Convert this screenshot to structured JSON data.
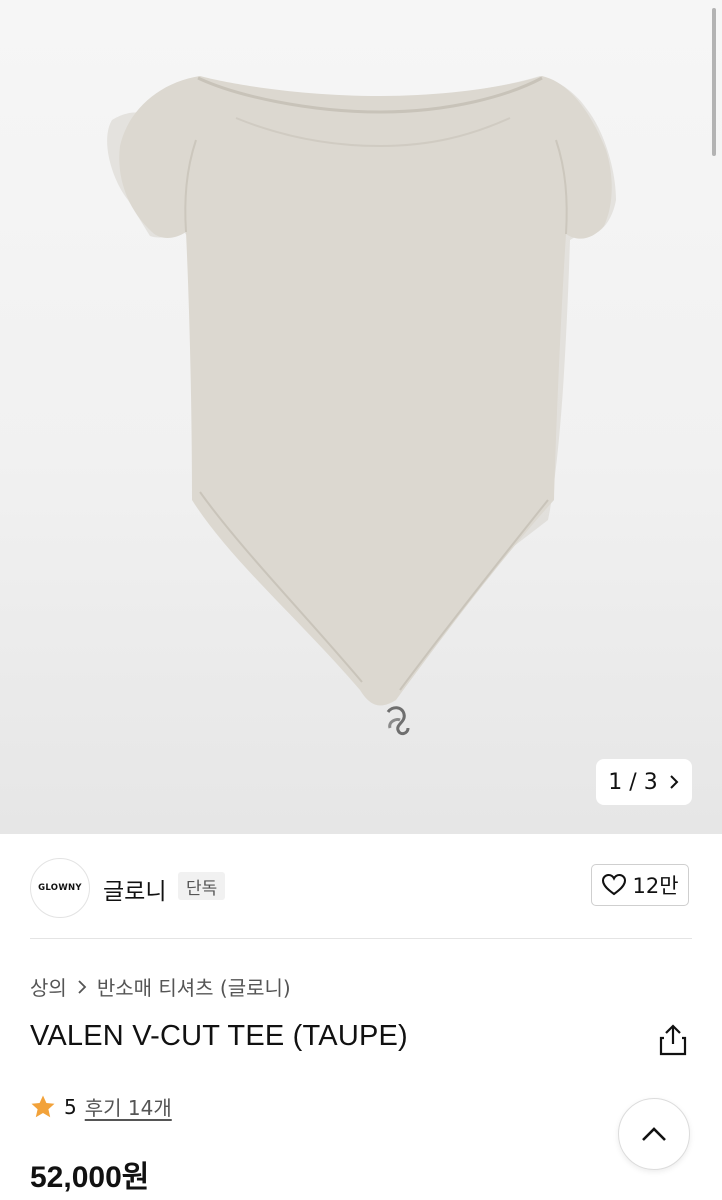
{
  "gallery": {
    "image_alt": "VALEN V-CUT TEE (TAUPE)",
    "pager_text": "1 / 3",
    "product_color": "#dcd8d0"
  },
  "brand": {
    "logo_text": "GLOWNY",
    "name": "글로니",
    "badge": "단독"
  },
  "like": {
    "count": "12만"
  },
  "breadcrumb": {
    "items": [
      "상의",
      "반소매 티셔츠 (글로니)"
    ]
  },
  "product": {
    "title": "VALEN V-CUT TEE (TAUPE)",
    "rating": "5",
    "review_text": "후기 14개",
    "price": "52,000원"
  },
  "icons": {
    "pager_next": "chevron-right-icon",
    "like": "heart-icon",
    "share": "share-icon",
    "rating": "star-icon",
    "scroll_top": "chevron-up-icon"
  },
  "colors": {
    "star": "#f2a23a"
  }
}
